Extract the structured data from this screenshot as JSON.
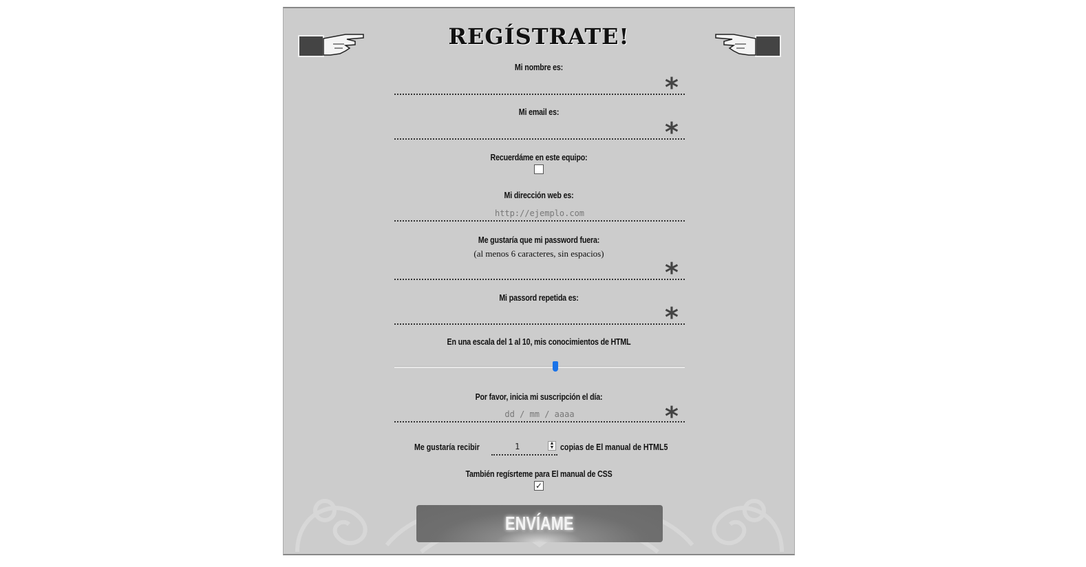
{
  "form": {
    "title": "REGÍSTRATE!",
    "name_label": "Mi nombre es:",
    "email_label": "Mi email es:",
    "remember_label": "Recuerdáme en este equipo:",
    "remember_checked": false,
    "website_label": "Mi dirección web es:",
    "website_placeholder": "http://ejemplo.com",
    "password_label": "Me gustaría que mi password fuera:",
    "password_hint": "(al menos 6 caracteres, sin espacios)",
    "password_repeat_label": "Mi passord repetida es:",
    "skill_label": "En una escala del 1 al 10, mis conocimientos de HTML",
    "skill_value": 5.5,
    "skill_min": 1,
    "skill_max": 10,
    "start_date_label": "Por favor, inicia mi suscripción el día:",
    "start_date_placeholder": "dd / mm / aaaa",
    "copies_prefix": "Me gustaría recibir",
    "copies_value": "1",
    "copies_suffix": "copias de El manual de HTML5",
    "css_label": "También regísrteme para El manual de CSS",
    "css_checked": true,
    "check_glyph": "✓",
    "required_marker": "*",
    "submit_label": "ENVÍAME"
  },
  "colors": {
    "panel": "#cccccc",
    "slider_thumb": "#1a73e8",
    "button": "#6f6f6f"
  },
  "icons": {
    "left_hand": "pointing-hand-right-icon",
    "right_hand": "pointing-hand-left-icon"
  }
}
